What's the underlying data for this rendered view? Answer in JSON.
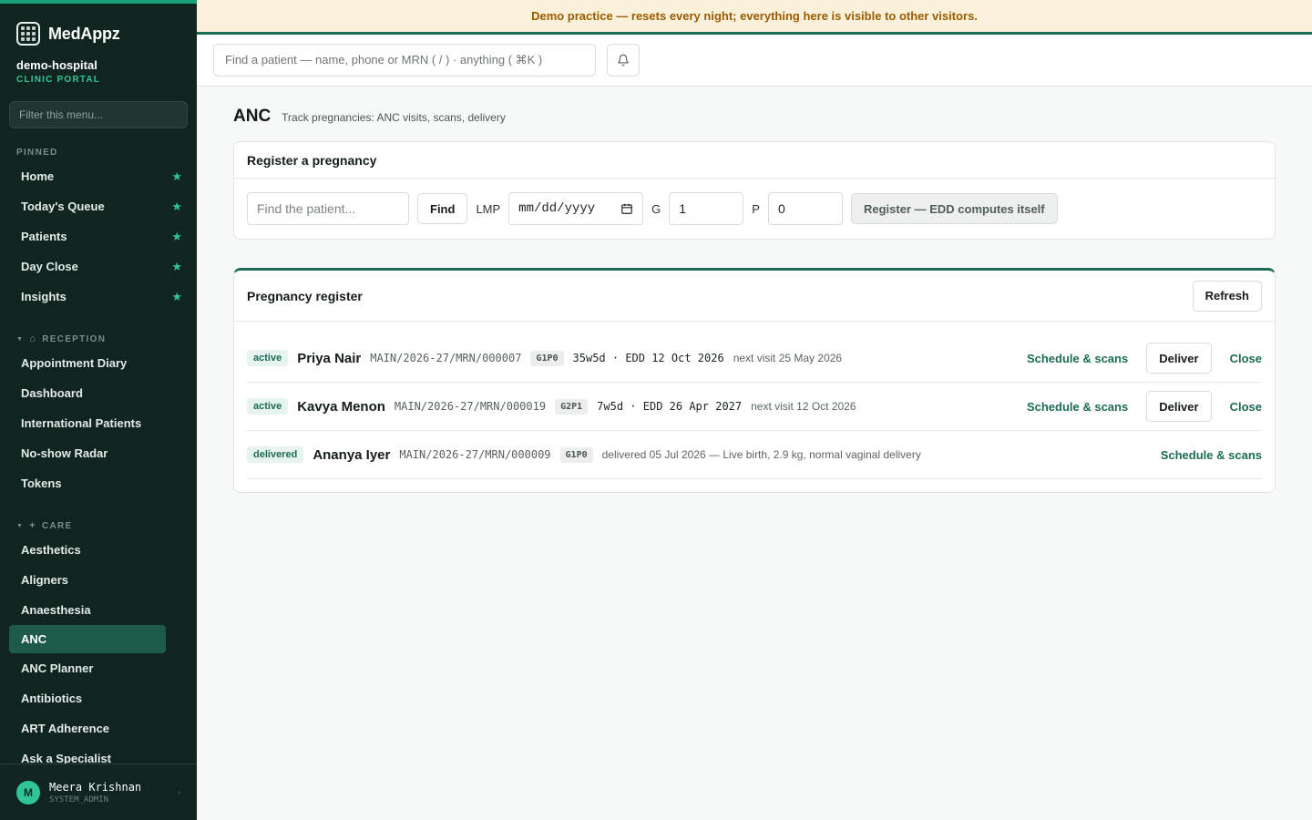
{
  "banner": "Demo practice — resets every night; everything here is visible to other visitors.",
  "brand": {
    "name": "MedAppz"
  },
  "tenant": {
    "name": "demo-hospital",
    "subtitle": "CLINIC PORTAL"
  },
  "sidebar": {
    "filter_placeholder": "Filter this menu...",
    "pinned_label": "PINNED",
    "pinned": [
      "Home",
      "Today's Queue",
      "Patients",
      "Day Close",
      "Insights"
    ],
    "reception_label": "RECEPTION",
    "reception": [
      "Appointment Diary",
      "Dashboard",
      "International Patients",
      "No-show Radar",
      "Tokens"
    ],
    "care_label": "CARE",
    "care": [
      "Aesthetics",
      "Aligners",
      "Anaesthesia",
      "ANC",
      "ANC Planner",
      "Antibiotics",
      "ART Adherence",
      "Ask a Specialist"
    ],
    "active_item": "ANC"
  },
  "user": {
    "initial": "M",
    "name": "Meera Krishnan",
    "role": "SYSTEM_ADMIN"
  },
  "topbar": {
    "search_placeholder": "Find a patient — name, phone or MRN ( / ) · anything ( ⌘K )"
  },
  "page": {
    "title": "ANC",
    "subtitle": "Track pregnancies: ANC visits, scans, delivery"
  },
  "register_form": {
    "title": "Register a pregnancy",
    "patient_placeholder": "Find the patient...",
    "find_label": "Find",
    "lmp_label": "LMP",
    "lmp_placeholder": "mm/dd/yyyy",
    "g_label": "G",
    "g_value": "1",
    "p_label": "P",
    "p_value": "0",
    "submit_label": "Register — EDD computes itself"
  },
  "register_list": {
    "title": "Pregnancy register",
    "refresh_label": "Refresh",
    "rows": [
      {
        "status": "active",
        "name": "Priya Nair",
        "mrn": "MAIN/2026-27/MRN/000007",
        "gp": "G1P0",
        "ga": "35w5d · EDD 12 Oct 2026",
        "note": "next visit 25 May 2026",
        "schedule": "Schedule & scans",
        "deliver": "Deliver",
        "close": "Close"
      },
      {
        "status": "active",
        "name": "Kavya Menon",
        "mrn": "MAIN/2026-27/MRN/000019",
        "gp": "G2P1",
        "ga": "7w5d · EDD 26 Apr 2027",
        "note": "next visit 12 Oct 2026",
        "schedule": "Schedule & scans",
        "deliver": "Deliver",
        "close": "Close"
      },
      {
        "status": "delivered",
        "name": "Ananya Iyer",
        "mrn": "MAIN/2026-27/MRN/000009",
        "gp": "G1P0",
        "ga": "",
        "note": "delivered 05 Jul 2026 — Live birth, 2.9 kg, normal vaginal delivery",
        "schedule": "Schedule & scans",
        "deliver": "",
        "close": ""
      }
    ]
  },
  "colors": {
    "accent": "#1b6b56",
    "sidebar_bg": "#102420",
    "banner_bg": "#fbf1da",
    "star": "#2fc596"
  }
}
